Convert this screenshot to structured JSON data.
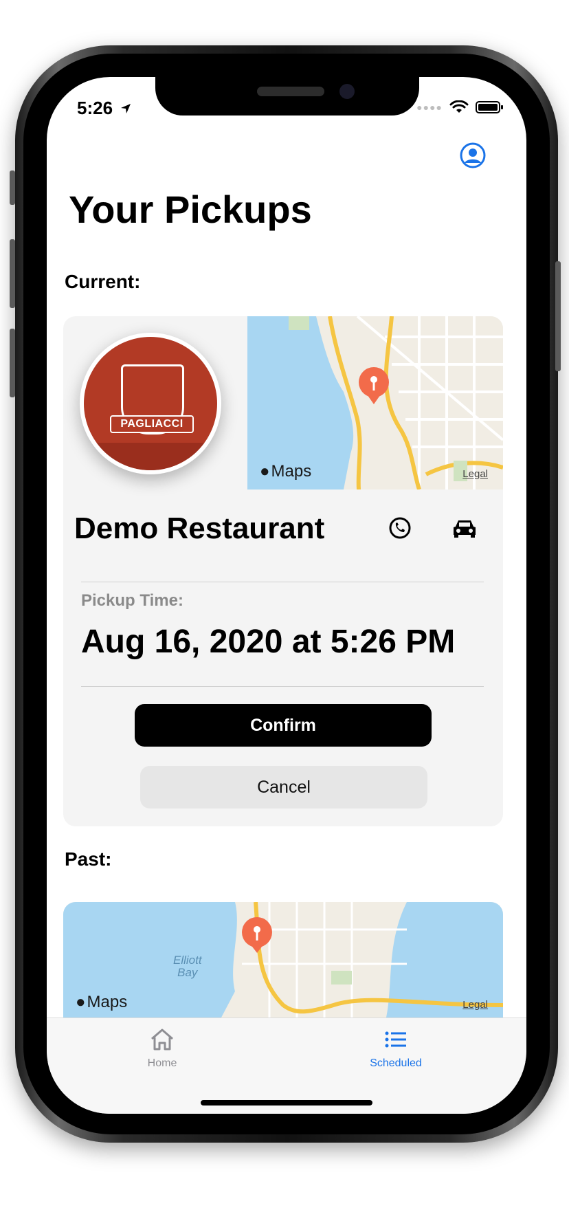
{
  "status_bar": {
    "time": "5:26",
    "location_icon": "location-arrow-icon",
    "signal_icon": "cellular-signal-icon",
    "wifi_icon": "wifi-icon",
    "battery_icon": "battery-icon"
  },
  "header": {
    "profile_icon": "person-circle-icon",
    "title": "Your Pickups"
  },
  "current_section": {
    "label": "Current:",
    "card": {
      "logo_text": "PAGLIACCI",
      "map": {
        "brand": "Maps",
        "legal": "Legal"
      },
      "restaurant_name": "Demo Restaurant",
      "phone_icon": "phone-icon",
      "car_icon": "car-icon",
      "pickup_label": "Pickup Time:",
      "pickup_time": "Aug 16, 2020 at 5:26 PM",
      "confirm_label": "Confirm",
      "cancel_label": "Cancel"
    }
  },
  "past_section": {
    "label": "Past:",
    "map": {
      "brand": "Maps",
      "legal": "Legal",
      "label_1": "Elliott",
      "label_2": "Bay"
    }
  },
  "tabbar": {
    "items": [
      {
        "label": "Home",
        "icon": "house-icon",
        "selected": false
      },
      {
        "label": "Scheduled",
        "icon": "list-icon",
        "selected": true
      }
    ]
  },
  "colors": {
    "accent": "#1a73e8",
    "map_pin": "#f26b4a",
    "water": "#a8d6f2",
    "logo_red": "#b23a25"
  }
}
